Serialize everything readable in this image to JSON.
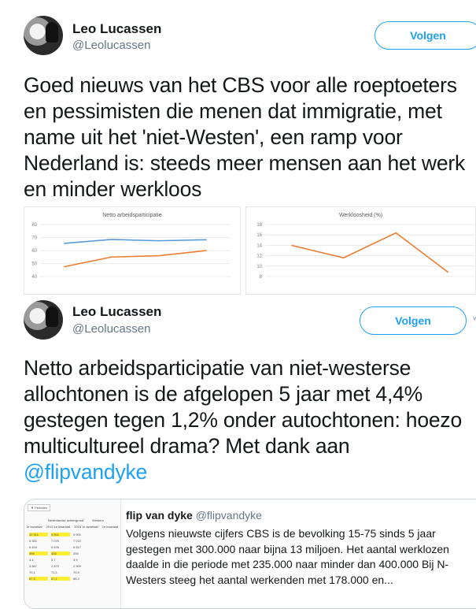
{
  "tweets": [
    {
      "author_name": "Leo Lucassen",
      "author_handle": "@Leolucassen",
      "follow_label": "Volgen",
      "text": "Goed nieuws van het CBS voor alle roeptoeters en pessimisten die menen dat immigratie, met name uit het 'niet-Westen', een ramp voor Nederland is: steeds meer mensen aan het werk en minder werkloos"
    },
    {
      "author_name": "Leo Lucassen",
      "author_handle": "@Leolucassen",
      "follow_label": "Volgen",
      "text": "Netto arbeidsparticipatie van niet-westerse allochtonen is de afgelopen 5 jaar met 4,4% gestegen tegen 1,2% onder autochtonen: hoezo multicultureel drama? Met dank aan ",
      "mention": "@flipvandyke"
    }
  ],
  "quoted_tweet": {
    "author_name": "flip van dyke",
    "author_handle": "@flipvandyke",
    "text": "Volgens nieuwste cijfers CBS is de bevolking 15-75 sinds 5 jaar gestegen met 300.000 naar bijna 13 miljoen. Het aantal werklozen daalde in die periode met 235.000 naar minder dan 400.000 Bij N-Westers steeg het aantal werkenden met 178.000 en..."
  },
  "colors": {
    "accent": "#1da1f2",
    "blue_line": "#5b9bd5",
    "orange_line": "#ed7d31"
  },
  "chart_data": [
    {
      "type": "line",
      "title": "Netto arbeidsparticipatie",
      "ylim": [
        40,
        80
      ],
      "yticks": [
        "80",
        "70",
        "60",
        "50",
        "40"
      ],
      "series": [
        {
          "color": "#5b9bd5",
          "values": [
            65.5,
            68.5,
            67.5,
            68.3
          ]
        },
        {
          "color": "#ed7d31",
          "values": [
            47.5,
            55,
            56,
            60
          ]
        }
      ]
    },
    {
      "type": "line",
      "title": "Werkloosheid (%)",
      "ylim": [
        8,
        18
      ],
      "yticks": [
        "18",
        "16",
        "14",
        "12",
        "10",
        "8"
      ],
      "series": [
        {
          "color": "#ed7d31",
          "values": [
            14,
            11.6,
            16.4,
            8.8
          ]
        }
      ]
    }
  ],
  "quote_thumbnail": {
    "header": "Perioden",
    "col_group": "Nederlandse achtergrond",
    "col_group2": "Westers",
    "col_labels": [
      "1e kwartaal",
      "2013 1e kwartaal",
      "2018 1e kwartaal",
      "1e kwartaal"
    ],
    "rows": [
      [
        "12 911",
        "9 901",
        "9 901"
      ],
      [
        "9 301",
        "7 079",
        "7 072"
      ],
      [
        "6 404",
        "6 676",
        "6 617"
      ],
      [
        "396",
        "403",
        "255"
      ],
      [
        "4,4",
        "5,7",
        "3,9"
      ],
      [
        "3 667",
        "2 872",
        "2 909"
      ],
      [
        "70,1",
        "71,1",
        "70,9"
      ],
      [
        "67,3",
        "67,1",
        "68,3"
      ]
    ]
  }
}
